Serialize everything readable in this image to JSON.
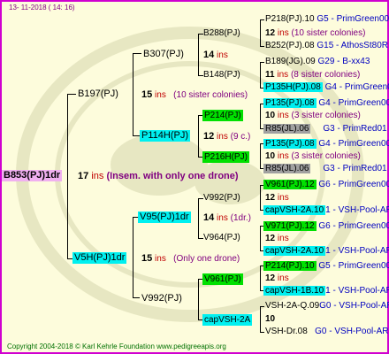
{
  "date": "13- 11-2018 ( 14: 16)",
  "copyright": "Copyright 2004-2018 © Karl Kehrle Foundation   www.pedigreeapis.org",
  "root": {
    "name": "B853(PJ)1dr",
    "count": "17",
    "ins": "ins",
    "note": "(Insem. with only one drone)"
  },
  "gen1": {
    "father": {
      "name": "B197(PJ)",
      "count": "15",
      "ins": "ins",
      "note": "(10 sister colonies)"
    },
    "mother": {
      "name": "V5H(PJ)1dr",
      "count": "15",
      "ins": "ins",
      "note": "(Only one drone)"
    }
  },
  "gen2": {
    "b307": {
      "name": "B307(PJ)",
      "count": "14",
      "ins": "ins"
    },
    "p114h": {
      "name": "P114H(PJ)",
      "count": "12",
      "ins": "ins",
      "note": "(9 c.)"
    },
    "v95": {
      "name": "V95(PJ)1dr",
      "count": "14",
      "ins": "ins",
      "note": "(1dr.)"
    },
    "v992": {
      "name": "V992(PJ)"
    }
  },
  "gen3": {
    "b288": {
      "name": "B288(PJ)",
      "count": "",
      "ins": ""
    },
    "b148": {
      "name": "B148(PJ)",
      "count": "11",
      "ins": "ins"
    },
    "p214": {
      "name": "P214(PJ)",
      "count": "10",
      "ins": "ins"
    },
    "p216h": {
      "name": "P216H(PJ)",
      "count": "10",
      "ins": "ins"
    },
    "v992a": {
      "name": "V992(PJ)",
      "count": "12",
      "ins": "ins"
    },
    "v964": {
      "name": "V964(PJ)",
      "count": "12",
      "ins": "ins"
    },
    "v961": {
      "name": "V961(PJ)",
      "count": "12",
      "ins": "ins"
    },
    "capvsh2a": {
      "name": "capVSH-2A",
      "count": "10",
      "ins": ""
    }
  },
  "gen4": [
    {
      "name": "P218(PJ).10",
      "tail": "G5 - PrimGreen00"
    },
    {
      "count": "12",
      "ins": "ins",
      "note": "(10 sister colonies)"
    },
    {
      "name": "B252(PJ).08",
      "tail": "G15 - AthosSt80R"
    },
    {
      "name": "B189(JG).09",
      "tail": "G29 - B-xx43"
    },
    {
      "count": "11",
      "ins": "ins",
      "note": "(8 sister colonies)"
    },
    {
      "name": "P135H(PJ).08",
      "tail": "G4 - PrimGreen00"
    },
    {
      "name": "P135(PJ).08",
      "tail": "G4 - PrimGreen00"
    },
    {
      "count": "10",
      "ins": "ins",
      "note": "(3 sister colonies)"
    },
    {
      "name": "R85(JL).06",
      "tail": "G3 - PrimRed01"
    },
    {
      "name": "P135(PJ).08",
      "tail": "G4 - PrimGreen00"
    },
    {
      "count": "10",
      "ins": "ins",
      "note": "(3 sister colonies)"
    },
    {
      "name": "R85(JL).06",
      "tail": "G3 - PrimRed01"
    },
    {
      "name": "V961(PJ).12",
      "tail": "G6 - PrimGreen00"
    },
    {
      "count": "12",
      "ins": "ins"
    },
    {
      "name": "capVSH-2A.10",
      "tail": "1 - VSH-Pool-AR"
    },
    {
      "name": "V971(PJ).12",
      "tail": "G6 - PrimGreen00"
    },
    {
      "count": "12",
      "ins": "ins"
    },
    {
      "name": "capVSH-2A.10",
      "tail": "1 - VSH-Pool-AR"
    },
    {
      "name": "P214(PJ).10",
      "tail": "G5 - PrimGreen00"
    },
    {
      "count": "12",
      "ins": "ins"
    },
    {
      "name": "capVSH-1B.10",
      "tail": "1 - VSH-Pool-AR"
    },
    {
      "name": "VSH-2A-Q.09",
      "tail": "G0 - VSH-Pool-AR"
    },
    {
      "count": "10"
    },
    {
      "name": "VSH-Dr.08",
      "tail": "G0 - VSH-Pool-AR"
    }
  ],
  "colors": {
    "frame": "#d000d0",
    "cyan": "#00f0f0",
    "lime": "#00e000",
    "gray": "#a0a0a0",
    "pink": "#f0b0f0",
    "background": "#fdfcdc"
  }
}
